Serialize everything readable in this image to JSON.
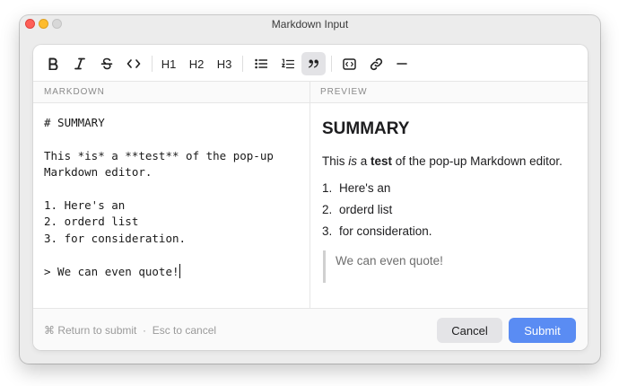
{
  "window": {
    "title": "Markdown Input"
  },
  "toolbar": {
    "items": [
      {
        "id": "bold",
        "icon": "bold-icon"
      },
      {
        "id": "italic",
        "icon": "italic-icon"
      },
      {
        "id": "strikethrough",
        "icon": "strikethrough-icon"
      },
      {
        "id": "code",
        "icon": "code-icon"
      },
      {
        "id": "h1",
        "label": "H1"
      },
      {
        "id": "h2",
        "label": "H2"
      },
      {
        "id": "h3",
        "label": "H3"
      },
      {
        "id": "bullet-list",
        "icon": "bullet-list-icon"
      },
      {
        "id": "numbered-list",
        "icon": "numbered-list-icon"
      },
      {
        "id": "quote",
        "icon": "quote-icon",
        "active": true
      },
      {
        "id": "code-block",
        "icon": "code-block-icon"
      },
      {
        "id": "link",
        "icon": "link-icon"
      },
      {
        "id": "horizontal-rule",
        "icon": "horizontal-rule-icon"
      }
    ],
    "h1_label": "H1",
    "h2_label": "H2",
    "h3_label": "H3"
  },
  "panes": {
    "markdown_label": "MARKDOWN",
    "preview_label": "PREVIEW"
  },
  "editor": {
    "lines": [
      "# SUMMARY",
      "",
      "This *is* a **test** of the pop-up",
      "Markdown editor.",
      "",
      "1. Here's an",
      "2. orderd list",
      "3. for consideration.",
      "",
      "> We can even quote!"
    ]
  },
  "preview": {
    "heading": "SUMMARY",
    "para_prefix": "This ",
    "para_italic": "is",
    "para_mid": " a ",
    "para_bold": "test",
    "para_suffix": " of the pop-up Markdown editor.",
    "list": [
      {
        "num": "1.",
        "text": "Here's an"
      },
      {
        "num": "2.",
        "text": "orderd list"
      },
      {
        "num": "3.",
        "text": "for consideration."
      }
    ],
    "quote": "We can even quote!"
  },
  "footer": {
    "hint": "⌘ Return to submit  ·  Esc to cancel",
    "cancel_label": "Cancel",
    "submit_label": "Submit"
  },
  "colors": {
    "accent": "#5a8cf3",
    "active_tool": "#e3e3e6",
    "quote_bar": "#d0d0d0"
  }
}
